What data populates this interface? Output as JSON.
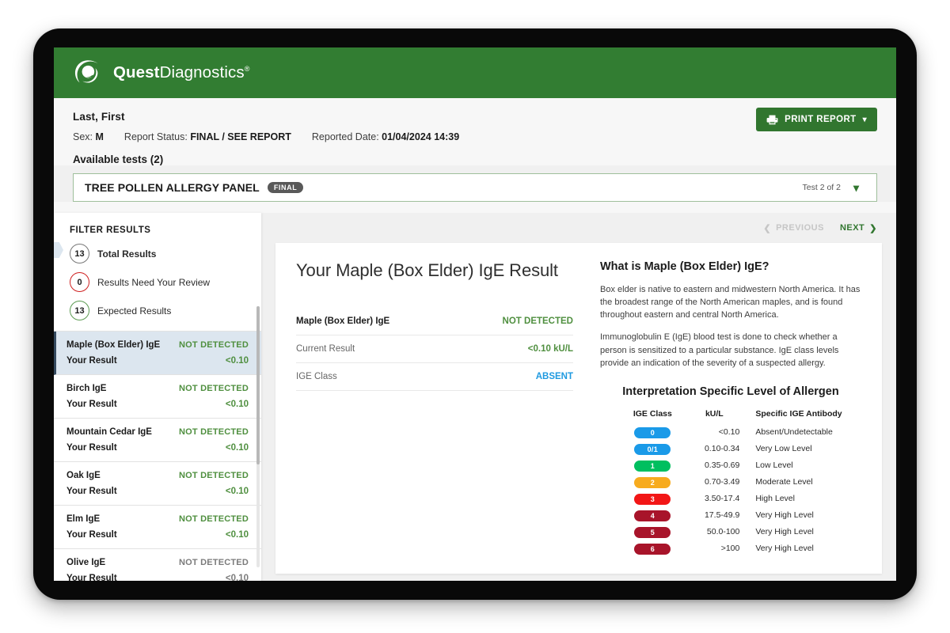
{
  "brand": {
    "name_bold": "Quest",
    "name_light": "Diagnostics",
    "trademark": "®",
    "logo_icon": "quest-swirl-logo"
  },
  "patient": {
    "name": "Last, First",
    "sex_label": "Sex:",
    "sex_value": "M",
    "report_status_label": "Report Status:",
    "report_status_value": "FINAL / SEE REPORT",
    "reported_date_label": "Reported Date:",
    "reported_date_value": "01/04/2024 14:39"
  },
  "toolbar": {
    "print_label": "PRINT REPORT",
    "print_icon": "printer-icon",
    "print_caret_icon": "chevron-down-icon"
  },
  "tests": {
    "available_label": "Available tests (2)",
    "selected_name": "TREE POLLEN ALLERGY PANEL",
    "selected_status": "FINAL",
    "counter": "Test 2 of 2",
    "chevron_icon": "chevron-down-icon"
  },
  "sidebar": {
    "filter_title": "FILTER RESULTS",
    "filters": [
      {
        "count": "13",
        "label": "Total Results",
        "tone": "neutral"
      },
      {
        "count": "0",
        "label": "Results Need Your Review",
        "tone": "red"
      },
      {
        "count": "13",
        "label": "Expected Results",
        "tone": "green"
      }
    ],
    "your_result_label": "Your Result",
    "results": [
      {
        "analyte": "Maple (Box Elder) IgE",
        "flag": "NOT DETECTED",
        "value": "<0.10",
        "selected": true
      },
      {
        "analyte": "Birch IgE",
        "flag": "NOT DETECTED",
        "value": "<0.10",
        "selected": false
      },
      {
        "analyte": "Mountain Cedar IgE",
        "flag": "NOT DETECTED",
        "value": "<0.10",
        "selected": false
      },
      {
        "analyte": "Oak IgE",
        "flag": "NOT DETECTED",
        "value": "<0.10",
        "selected": false
      },
      {
        "analyte": "Elm IgE",
        "flag": "NOT DETECTED",
        "value": "<0.10",
        "selected": false
      },
      {
        "analyte": "Olive IgE",
        "flag": "NOT DETECTED",
        "value": "<0.10",
        "selected": false
      }
    ]
  },
  "pager": {
    "previous_label": "PREVIOUS",
    "next_label": "NEXT",
    "previous_icon": "chevron-left-icon",
    "next_icon": "chevron-right-icon"
  },
  "result": {
    "title": "Your Maple (Box Elder) IgE Result",
    "rows": [
      {
        "label": "Maple (Box Elder) IgE",
        "value": "NOT DETECTED",
        "tone": "green",
        "strong": true
      },
      {
        "label": "Current Result",
        "value": "<0.10 kU/L",
        "tone": "green",
        "strong": false
      },
      {
        "label": "IGE Class",
        "value": "ABSENT",
        "tone": "blue",
        "strong": false
      }
    ]
  },
  "info": {
    "heading": "What is Maple (Box Elder) IgE?",
    "paragraphs": [
      "Box elder is native to eastern and midwestern North America. It has the broadest range of the North American maples, and is found throughout eastern and central North America.",
      "Immunoglobulin E (IgE) blood test is done to check whether a person is sensitized to a particular substance.  IgE class levels provide an indication of the severity of a suspected allergy."
    ]
  },
  "interpretation": {
    "heading": "Interpretation Specific Level of Allergen",
    "columns": [
      "IGE Class",
      "kU/L",
      "Specific IGE Antibody"
    ],
    "rows": [
      {
        "class": "0",
        "kul": "<0.10",
        "antibody": "Absent/Undetectable",
        "color": "#1a9ae8"
      },
      {
        "class": "0/1",
        "kul": "0.10-0.34",
        "antibody": "Very Low Level",
        "color": "#1a9ae8"
      },
      {
        "class": "1",
        "kul": "0.35-0.69",
        "antibody": "Low Level",
        "color": "#00bf5f"
      },
      {
        "class": "2",
        "kul": "0.70-3.49",
        "antibody": "Moderate Level",
        "color": "#f7ab1e"
      },
      {
        "class": "3",
        "kul": "3.50-17.4",
        "antibody": "High Level",
        "color": "#f21616"
      },
      {
        "class": "4",
        "kul": "17.5-49.9",
        "antibody": "Very High Level",
        "color": "#a8142a"
      },
      {
        "class": "5",
        "kul": "50.0-100",
        "antibody": "Very High Level",
        "color": "#a8142a"
      },
      {
        "class": "6",
        "kul": ">100",
        "antibody": "Very High Level",
        "color": "#a8142a"
      }
    ]
  },
  "colors": {
    "brand_green": "#327d32",
    "button_green": "#31762f",
    "result_green": "#4f8f3f",
    "link_blue": "#1f9ae0",
    "selected_row": "#dce6ef"
  }
}
